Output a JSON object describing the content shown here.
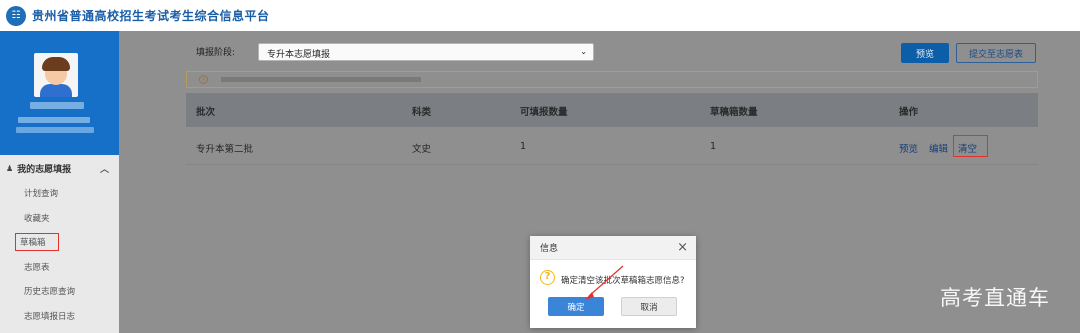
{
  "header": {
    "title": "贵州省普通高校招生考试考生综合信息平台"
  },
  "sidebar": {
    "group_label": "我的志愿填报",
    "items": [
      {
        "label": "计划查询"
      },
      {
        "label": "收藏夹"
      },
      {
        "label": "草稿箱"
      },
      {
        "label": "志愿表"
      },
      {
        "label": "历史志愿查询"
      },
      {
        "label": "志愿填报日志"
      }
    ]
  },
  "toolbar": {
    "stage_label": "填报阶段:",
    "stage_value": "专升本志愿填报",
    "preview_label": "预览",
    "submit_label": "提交至志愿表"
  },
  "table": {
    "headers": [
      "批次",
      "科类",
      "可填报数量",
      "草稿箱数量",
      "操作"
    ],
    "rows": [
      {
        "batch": "专升本第二批",
        "category": "文史",
        "available": "1",
        "drafts": "1",
        "ops": [
          "预览",
          "编辑",
          "清空"
        ]
      }
    ]
  },
  "dialog": {
    "title": "信息",
    "message": "确定清空该批次草稿箱志愿信息?",
    "ok_label": "确定",
    "cancel_label": "取消"
  },
  "watermark": "高考直通车",
  "colors": {
    "brand": "#1670c8",
    "primary_button": "#0c5ea8",
    "highlight_red": "#e0322e",
    "question_icon": "#f3b619"
  }
}
